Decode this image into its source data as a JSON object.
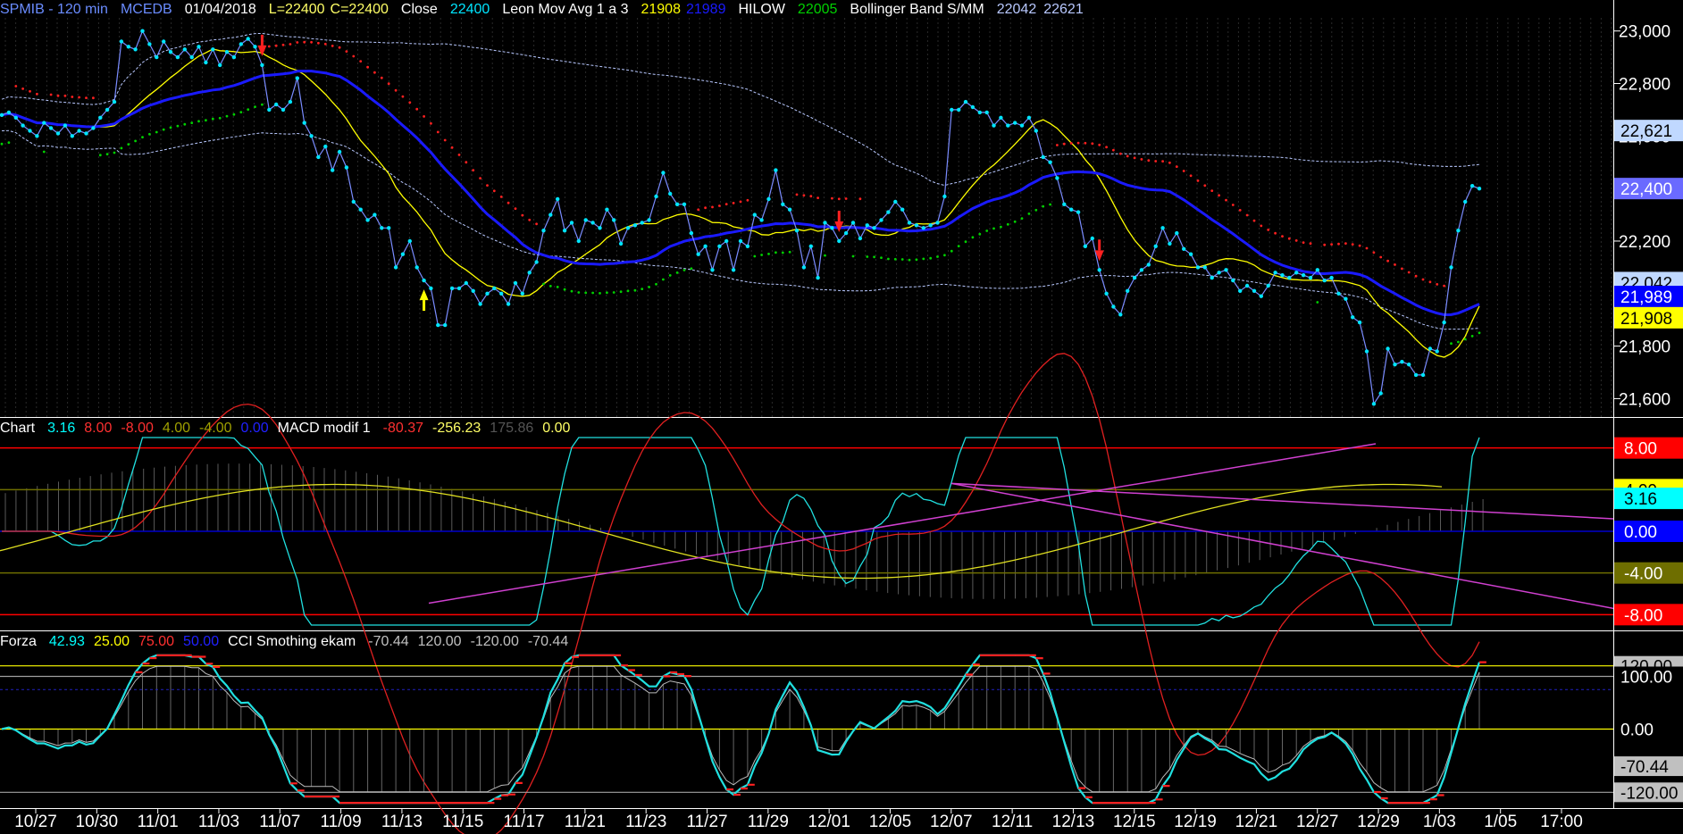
{
  "header": {
    "symbol": "SPMIB - 120 min",
    "source": "MCEDB",
    "date": "01/04/2018",
    "low": "L=22400",
    "close_c": "C=22400",
    "close_label": "Close",
    "close_value": "22400",
    "leon_label": "Leon Mov Avg 1 a 3",
    "leon_v1": "21908",
    "leon_v2": "21989",
    "hilow_label": "HILOW",
    "hilow_value": "22005",
    "bb_label": "Bollinger Band S/MM",
    "bb_v1": "22042",
    "bb_v2": "22621"
  },
  "macd_header": {
    "label": "Chart",
    "v1": "3.16",
    "v2": "8.00",
    "v3": "-8.00",
    "v4": "4.00",
    "v5": "-4.00",
    "v6": "0.00",
    "name": "MACD modif 1",
    "v7": "-80.37",
    "v8": "-256.23",
    "v9": "175.86",
    "v10": "0.00"
  },
  "cci_header": {
    "label": "Forza",
    "v1": "42.93",
    "v2": "25.00",
    "v3": "75.00",
    "v4": "50.00",
    "name": "CCI Smothing ekam",
    "v5": "-70.44",
    "v6": "120.00",
    "v7": "-120.00",
    "v8": "-70.44"
  },
  "colors": {
    "price": "#00e5ff",
    "ma_blue": "#1a1aff",
    "ma_yellow": "#ffff00",
    "hilow_red": "#ff2020",
    "hilow_green": "#00d000",
    "bollinger": "#b8c8ff",
    "magenta": "#d040d0",
    "label_box": "#c0d8ff"
  },
  "chart_data": {
    "type": "line",
    "x_tick_labels": [
      "10/27",
      "10/30",
      "11/01",
      "11/03",
      "11/07",
      "11/09",
      "11/13",
      "11/15",
      "11/17",
      "11/21",
      "11/23",
      "11/27",
      "11/29",
      "12/01",
      "12/05",
      "12/07",
      "12/11",
      "12/13",
      "12/15",
      "12/19",
      "12/21",
      "12/27",
      "12/29",
      "1/03",
      "1/05",
      "17:00"
    ],
    "price_panel": {
      "y_ticks": [
        "23,000",
        "22,800",
        "22,600",
        "22,400",
        "22,200",
        "22,000",
        "21,800",
        "21,600"
      ],
      "ylim": [
        21530,
        23050
      ],
      "right_labels": [
        {
          "text": "22,621",
          "value": 22621,
          "bg": "#c0d8ff",
          "fg": "#000000"
        },
        {
          "text": "22,400",
          "value": 22400,
          "bg": "#6a6aff",
          "fg": "#ffffff"
        },
        {
          "text": "22,042",
          "value": 22042,
          "bg": "#c0d8ff",
          "fg": "#000000"
        },
        {
          "text": "21,989",
          "value": 21989,
          "bg": "#0000ff",
          "fg": "#ffffff"
        },
        {
          "text": "21,908",
          "value": 21908,
          "bg": "#ffff00",
          "fg": "#000000"
        }
      ],
      "close_series": [
        22680,
        22690,
        22670,
        22640,
        22620,
        22600,
        22650,
        22630,
        22610,
        22640,
        22600,
        22620,
        22610,
        22630,
        22670,
        22700,
        22730,
        22960,
        22940,
        22930,
        23000,
        22950,
        22900,
        22960,
        22920,
        22900,
        22930,
        22900,
        22940,
        22880,
        22930,
        22870,
        22920,
        22900,
        22950,
        22970,
        22940,
        22870,
        22700,
        22720,
        22700,
        22730,
        22820,
        22650,
        22600,
        22520,
        22560,
        22470,
        22540,
        22480,
        22350,
        22320,
        22280,
        22300,
        22250,
        22250,
        22100,
        22150,
        22200,
        22100,
        22050,
        22020,
        21880,
        21880,
        22020,
        22020,
        22040,
        22010,
        21960,
        22000,
        22020,
        22000,
        21960,
        22040,
        22000,
        22080,
        22120,
        22240,
        22300,
        22360,
        22240,
        22270,
        22200,
        22280,
        22270,
        22250,
        22320,
        22280,
        22190,
        22250,
        22260,
        22270,
        22280,
        22370,
        22460,
        22380,
        22340,
        22340,
        22230,
        22150,
        22180,
        22090,
        22180,
        22200,
        22090,
        22200,
        22180,
        22300,
        22280,
        22360,
        22470,
        22340,
        22320,
        22240,
        22100,
        22180,
        22060,
        22270,
        22250,
        22200,
        22230,
        22270,
        22210,
        22260,
        22250,
        22280,
        22310,
        22350,
        22320,
        22270,
        22260,
        22250,
        22260,
        22270,
        22370,
        22700,
        22700,
        22730,
        22710,
        22690,
        22690,
        22640,
        22670,
        22640,
        22650,
        22640,
        22670,
        22620,
        22520,
        22500,
        22440,
        22340,
        22320,
        22310,
        22180,
        22210,
        22090,
        22000,
        21950,
        21920,
        22010,
        22060,
        22090,
        22110,
        22180,
        22250,
        22190,
        22230,
        22170,
        22150,
        22100,
        22100,
        22060,
        22080,
        22090,
        22050,
        22010,
        22030,
        22010,
        21990,
        22030,
        22080,
        22070,
        22060,
        22080,
        22070,
        22060,
        22090,
        22050,
        22060,
        22000,
        21980,
        21910,
        21890,
        21780,
        21580,
        21620,
        21790,
        21730,
        21740,
        21730,
        21690,
        21690,
        21790,
        21780,
        21890,
        22100,
        22240,
        22350,
        22410,
        22400
      ],
      "arrows": [
        {
          "index": 37,
          "dir": "down",
          "color": "#ff2020"
        },
        {
          "index": 60,
          "dir": "up",
          "color": "#ffff00"
        },
        {
          "index": 119,
          "dir": "down",
          "color": "#ff2020"
        },
        {
          "index": 156,
          "dir": "down",
          "color": "#ff2020"
        },
        {
          "index": 216,
          "dir": "up",
          "color": "#ffff00"
        }
      ]
    },
    "macd_panel": {
      "levels": [
        {
          "text": "8.00",
          "value": 8.0,
          "bg": "#ff0000",
          "fg": "#ffffff",
          "line": "#ff0000"
        },
        {
          "text": "4.00",
          "value": 4.0,
          "bg": "#ffff00",
          "fg": "#000000",
          "line": "#6e6e00"
        },
        {
          "text": "3.16",
          "value": 3.16,
          "bg": "#00ffff",
          "fg": "#000000",
          "line": null
        },
        {
          "text": "0.00",
          "value": 0.0,
          "bg": "#0000ff",
          "fg": "#ffffff",
          "line": "#0000cc"
        },
        {
          "text": "-4.00",
          "value": -4.0,
          "bg": "#6e6e00",
          "fg": "#ffffff",
          "line": "#6e6e00"
        },
        {
          "text": "-8.00",
          "value": -8.0,
          "bg": "#ff0000",
          "fg": "#ffffff",
          "line": "#ff0000"
        }
      ],
      "ylim": [
        -9,
        9
      ]
    },
    "cci_panel": {
      "levels": [
        {
          "text": "120.00",
          "value": 120,
          "bg": "#c0c0c0",
          "fg": "#000000",
          "line": "#ffff00"
        },
        {
          "text": "100.00",
          "value": 100,
          "bg": "#000000",
          "fg": "#ffffff",
          "line": "#a0a0a0"
        },
        {
          "text": "0.00",
          "value": 0,
          "bg": "#000000",
          "fg": "#ffffff",
          "line": "#ffff00"
        },
        {
          "text": "-70.44",
          "value": -70.44,
          "bg": "#c0c0c0",
          "fg": "#000000",
          "line": null
        },
        {
          "text": "-120.00",
          "value": -120,
          "bg": "#c0c0c0",
          "fg": "#000000",
          "line": "#a0a0a0"
        }
      ],
      "ylim": [
        -150,
        150
      ]
    }
  }
}
